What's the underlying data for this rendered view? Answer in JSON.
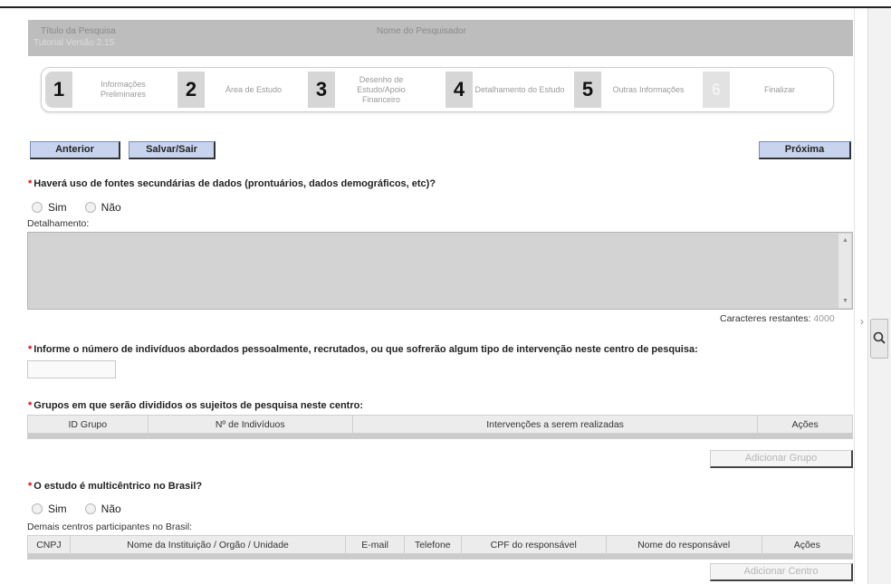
{
  "header": {
    "title_label": "Título da Pesquisa",
    "title_value": "Tutorial Versão 2.15",
    "researcher_label": "Nome do Pesquisador"
  },
  "steps": [
    {
      "num": "1",
      "label": "Informações Preliminares"
    },
    {
      "num": "2",
      "label": "Área de Estudo"
    },
    {
      "num": "3",
      "label": "Desenho de Estudo/Apoio Financeiro"
    },
    {
      "num": "4",
      "label": "Detalhamento do Estudo"
    },
    {
      "num": "5",
      "label": "Outras Informações"
    },
    {
      "num": "6",
      "label": "Finalizar"
    }
  ],
  "nav": {
    "prev_label": "Anterior",
    "save_label": "Salvar/Sair",
    "next_label": "Próxima"
  },
  "q_secondary": {
    "question": "Haverá uso de fontes secundárias de dados (prontuários, dados demográficos, etc)?",
    "opt_yes": "Sim",
    "opt_no": "Não",
    "detail_label": "Detalhamento:",
    "chars_label": "Caracteres restantes:",
    "chars_value": "4000"
  },
  "q_individuals": {
    "question": "Informe o número de indivíduos abordados pessoalmente, recrutados, ou que sofrerão algum tipo de intervenção neste centro de pesquisa:",
    "value": ""
  },
  "groups": {
    "question": "Grupos em que serão divididos os sujeitos de pesquisa neste centro:",
    "columns": [
      "ID Grupo",
      "Nº de Indivíduos",
      "Intervenções a serem realizadas",
      "Ações"
    ],
    "add_label": "Adicionar Grupo"
  },
  "multicenter": {
    "question": "O estudo é multicêntrico no Brasil?",
    "opt_yes": "Sim",
    "opt_no": "Não",
    "centers_label": "Demais centros participantes no Brasil:",
    "columns": [
      "CNPJ",
      "Nome da Instituição / Orgão / Unidade",
      "E-mail",
      "Telefone",
      "CPF do responsável",
      "Nome do responsável",
      "Ações"
    ],
    "add_label": "Adicionar Centro"
  },
  "colors": {
    "header_bg": "#bdbdbd",
    "button_bg": "#c8d4ee",
    "required": "#dd0000"
  }
}
